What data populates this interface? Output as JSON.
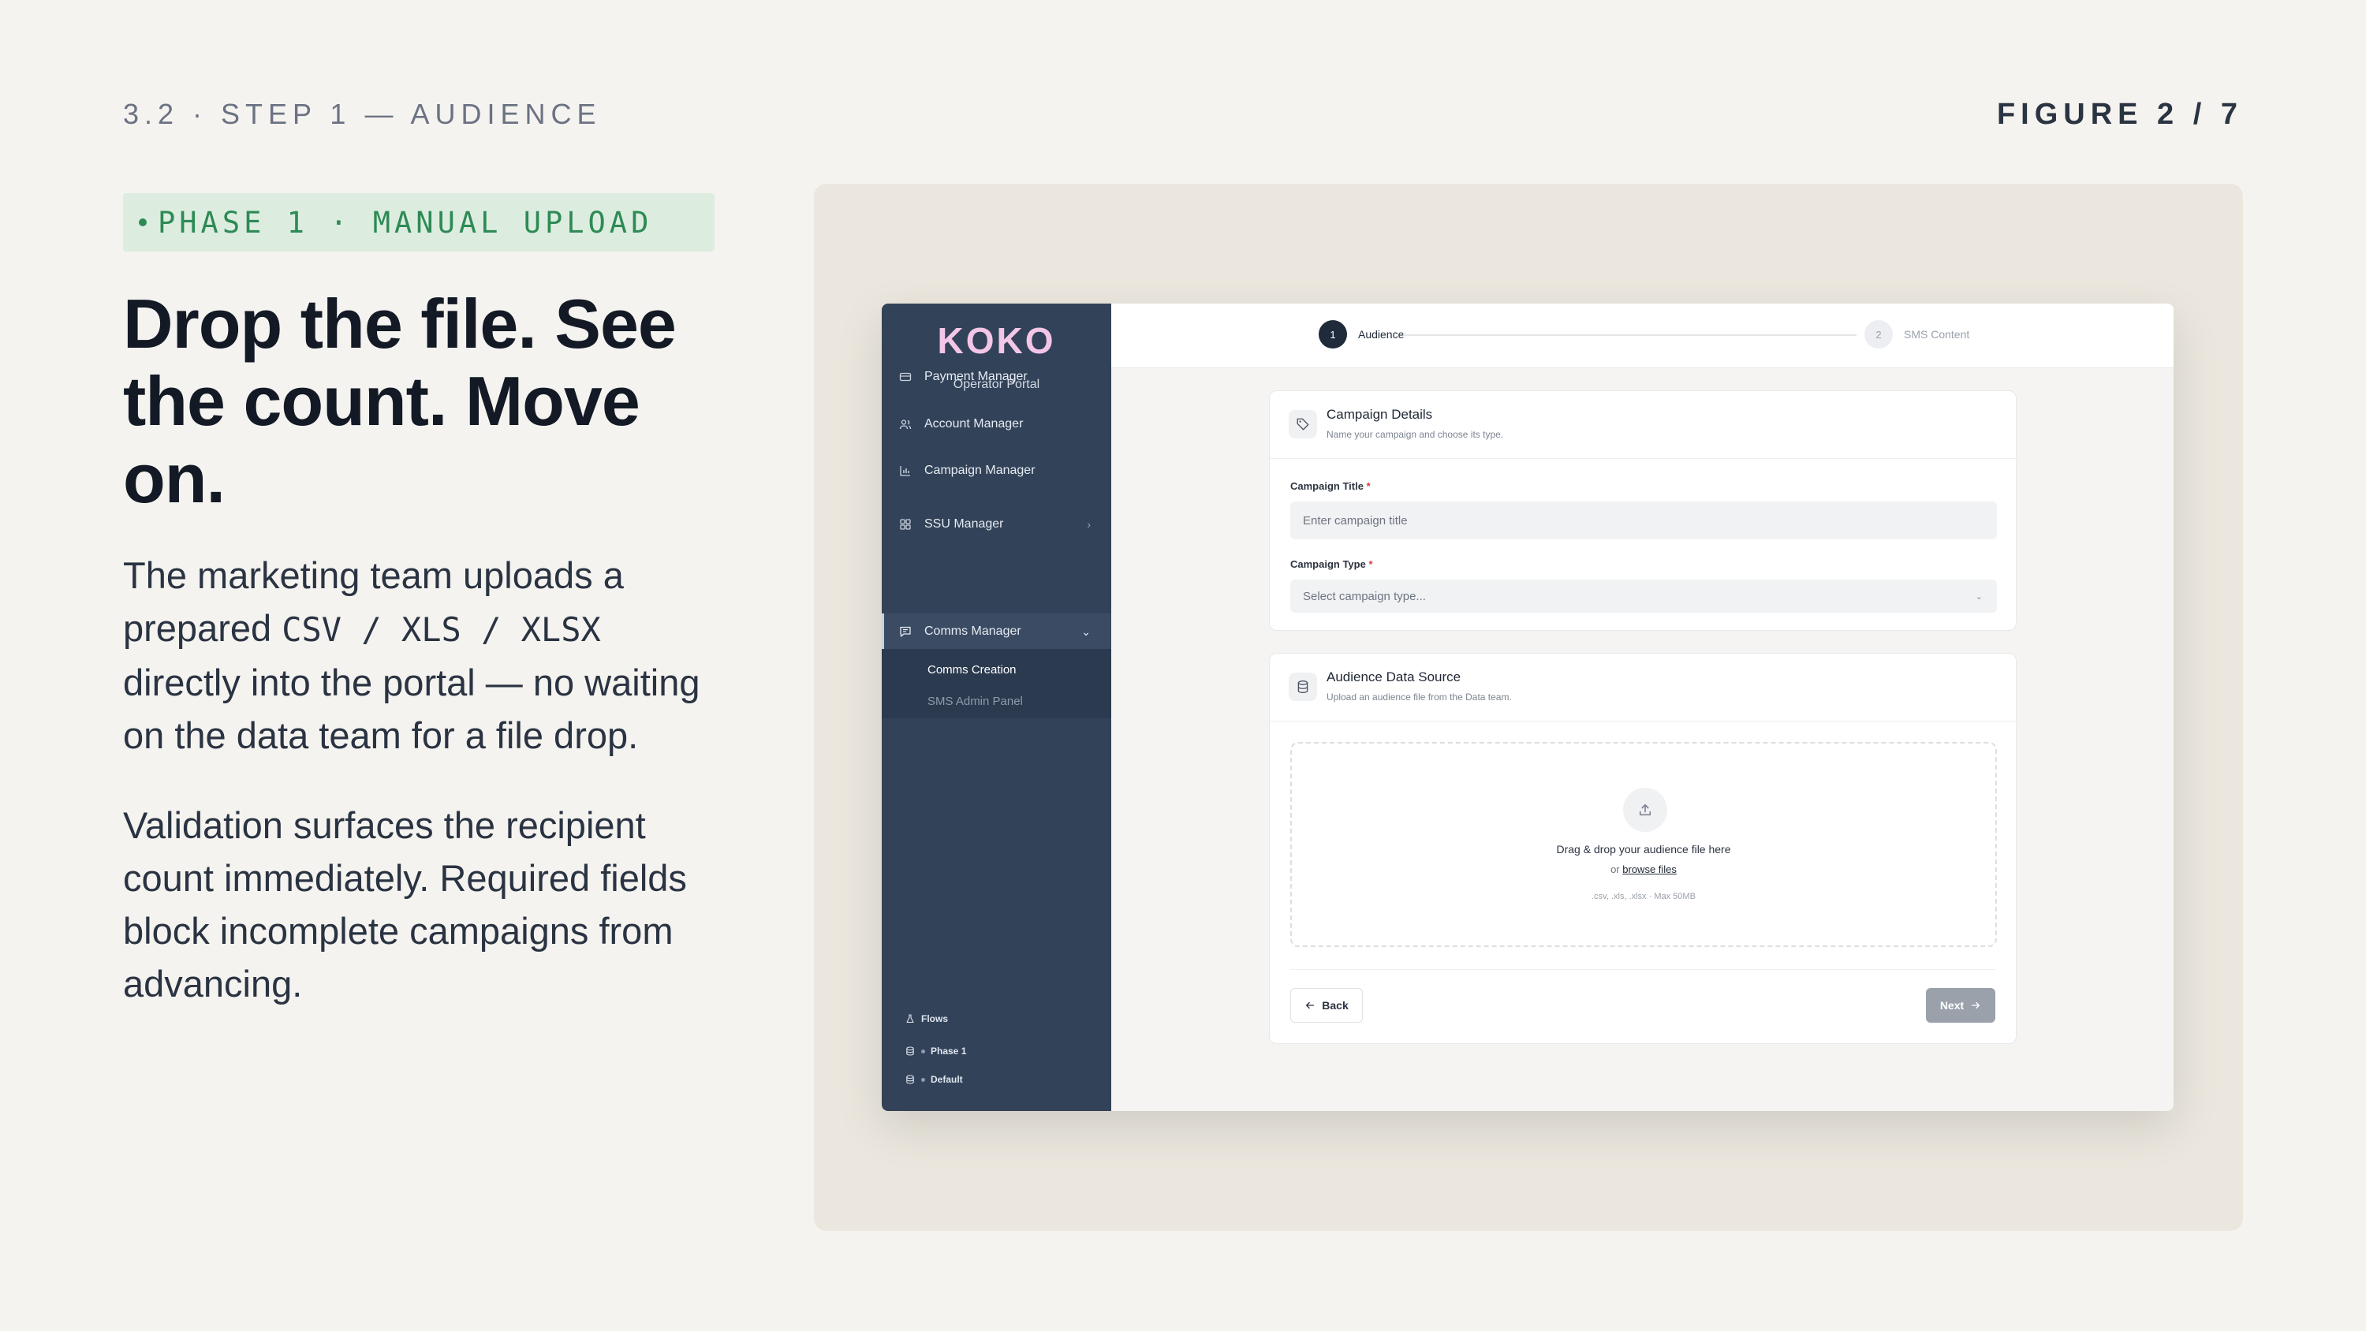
{
  "slide": {
    "eyebrow": "3.2 · STEP 1 — AUDIENCE",
    "figure": "FIGURE 2 / 7",
    "phase_badge": "PHASE 1 · MANUAL UPLOAD",
    "headline": "Drop the file. See the count. Move on.",
    "para1_a": "The marketing team uploads a prepared ",
    "para1_mono": "CSV / XLS / XLSX",
    "para1_b": " directly into the portal — no waiting on the data team for a file drop.",
    "para2": "Validation surfaces the recipient count immediately. Required fields block incomplete campaigns from advancing.",
    "colors": {
      "accent_green": "#2e8a55",
      "sidebar": "#324258",
      "badge_bg": "#dcede0"
    }
  },
  "app": {
    "logo": "KOKO",
    "portal_label": "Operator Portal",
    "nav": [
      {
        "label": "Payment Manager",
        "icon": "credit-card-icon"
      },
      {
        "label": "Account Manager",
        "icon": "users-icon"
      },
      {
        "label": "Campaign Manager",
        "icon": "bar-chart-icon"
      },
      {
        "label": "SSU Manager",
        "icon": "grid-icon"
      },
      {
        "label": "Comms Manager",
        "icon": "message-icon"
      }
    ],
    "subnav": [
      "Comms Creation",
      "SMS Admin Panel"
    ],
    "footer": {
      "flows": "Flows",
      "env1": "Phase 1",
      "env2": "Default"
    },
    "steps": [
      {
        "num": "1",
        "label": "Audience"
      },
      {
        "num": "2",
        "label": "SMS Content"
      }
    ],
    "campaign_details": {
      "title": "Campaign Details",
      "subtitle": "Name your campaign and choose its type.",
      "title_label": "Campaign Title",
      "title_placeholder": "Enter campaign title",
      "type_label": "Campaign Type",
      "type_value": "Select campaign type...",
      "required_mark": "*"
    },
    "audience": {
      "title": "Audience Data Source",
      "subtitle": "Upload an audience file from the Data team.",
      "drop_text": "Drag & drop your audience file here",
      "or_text": "or",
      "browse_text": "browse files",
      "formats": ".csv, .xls, .xlsx · Max 50MB"
    },
    "buttons": {
      "back": "Back",
      "next": "Next"
    }
  }
}
